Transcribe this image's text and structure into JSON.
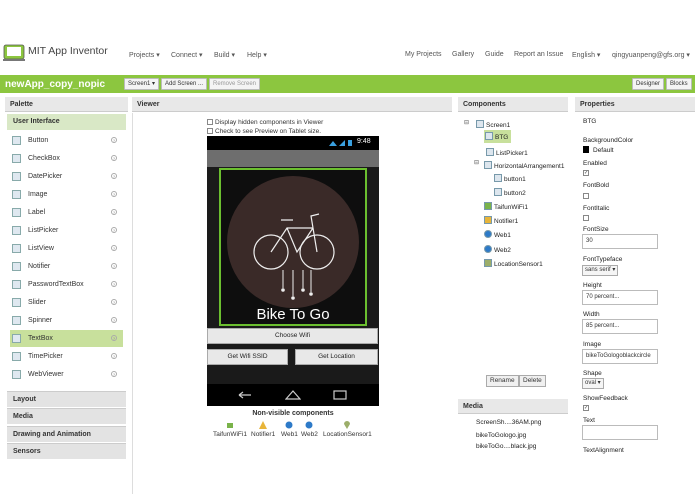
{
  "app": {
    "name": "MIT App Inventor"
  },
  "topnav": {
    "projects": "Projects ▾",
    "connect": "Connect ▾",
    "build": "Build ▾",
    "help": "Help ▾",
    "my_projects": "My Projects",
    "gallery": "Gallery",
    "guide": "Guide",
    "report": "Report an Issue",
    "language": "English ▾",
    "user": "qingyuanpeng@gfs.org ▾"
  },
  "project": {
    "name": "newApp_copy_nopic",
    "screen_select": "Screen1 ▾",
    "add_screen": "Add Screen ...",
    "remove_screen": "Remove Screen",
    "designer": "Designer",
    "blocks": "Blocks"
  },
  "palette": {
    "title": "Palette",
    "section": "User Interface",
    "items": [
      {
        "label": "Button",
        "icon": "button-icon"
      },
      {
        "label": "CheckBox",
        "icon": "checkbox-icon"
      },
      {
        "label": "DatePicker",
        "icon": "datepicker-icon"
      },
      {
        "label": "Image",
        "icon": "image-icon"
      },
      {
        "label": "Label",
        "icon": "label-icon"
      },
      {
        "label": "ListPicker",
        "icon": "listpicker-icon"
      },
      {
        "label": "ListView",
        "icon": "listview-icon"
      },
      {
        "label": "Notifier",
        "icon": "notifier-icon"
      },
      {
        "label": "PasswordTextBox",
        "icon": "password-icon"
      },
      {
        "label": "Slider",
        "icon": "slider-icon"
      },
      {
        "label": "Spinner",
        "icon": "spinner-icon"
      },
      {
        "label": "TextBox",
        "icon": "textbox-icon"
      },
      {
        "label": "TimePicker",
        "icon": "timepicker-icon"
      },
      {
        "label": "WebViewer",
        "icon": "webviewer-icon"
      }
    ],
    "help_glyph": "?",
    "categories": [
      "Layout",
      "Media",
      "Drawing and Animation",
      "Sensors"
    ]
  },
  "viewer": {
    "title": "Viewer",
    "chk_hidden": "Display hidden components in Viewer",
    "chk_tablet": "Check to see Preview on Tablet size.",
    "time": "9:48",
    "image_text": "Bike To Go",
    "choose_wifi": "Choose Wifi",
    "get_ssid": "Get Wifi SSID",
    "get_location": "Get Location",
    "nonvis_title": "Non-visible components",
    "nonvis": [
      "TaifunWiFi1",
      "Notifier1",
      "Web1",
      "Web2",
      "LocationSensor1"
    ]
  },
  "components": {
    "title": "Components",
    "toggle_open": "⊟",
    "tree": [
      "Screen1",
      "BTG",
      "ListPicker1",
      "HorizontalArrangement1",
      "button1",
      "button2",
      "TaifunWiFi1",
      "Notifier1",
      "Web1",
      "Web2",
      "LocationSensor1"
    ],
    "rename": "Rename",
    "delete": "Delete"
  },
  "media": {
    "title": "Media",
    "files": [
      "ScreenSh....36AM.png",
      "bikeToGologo.jpg",
      "bikeToGo....black.jpg"
    ]
  },
  "properties": {
    "title": "Properties",
    "component": "BTG",
    "bgcolor_label": "BackgroundColor",
    "bgcolor_value": "Default",
    "enabled_label": "Enabled",
    "enabled_checked": "✓",
    "fontbold_label": "FontBold",
    "fontitalic_label": "FontItalic",
    "fontsize_label": "FontSize",
    "fontsize_value": "30",
    "typeface_label": "FontTypeface",
    "typeface_value": "sans serif ▾",
    "height_label": "Height",
    "height_value": "70 percent...",
    "width_label": "Width",
    "width_value": "85 percent...",
    "image_label": "Image",
    "image_value": "bikeToGologoblackcircle",
    "shape_label": "Shape",
    "shape_value": "oval ▾",
    "showfeedback_label": "ShowFeedback",
    "showfeedback_checked": "✓",
    "text_label": "Text",
    "text_value": "",
    "textalign_label": "TextAlignment"
  },
  "colors": {
    "accent": "#8cc63f",
    "canvas_border": "#6bbf2f",
    "selected": "#c8e09c"
  }
}
